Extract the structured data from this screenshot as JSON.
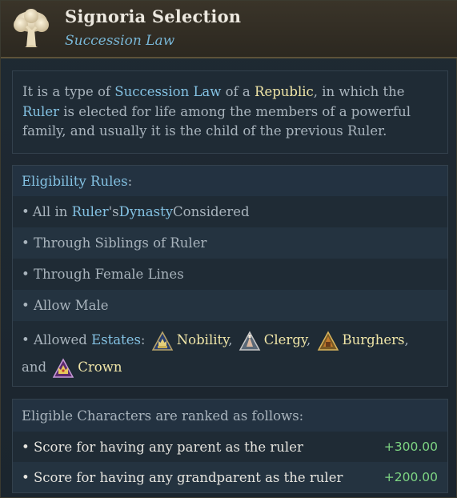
{
  "header": {
    "title": "Signoria Selection",
    "subtitle": "Succession Law",
    "icon": "tree-icon"
  },
  "description": {
    "part1": "It is a type of ",
    "kw1": "Succession Law",
    "part2": " of a ",
    "kw2": "Republic",
    "part3": ", in which the ",
    "kw3": "Ruler",
    "part4": " is elected for life among the members of a powerful family, and usually it is the child of the previous Ruler."
  },
  "eligibility": {
    "heading_kw": "Eligibility Rules",
    "heading_suffix": ":",
    "rule1": {
      "bullet": "•",
      "kw1": "Ruler",
      "t1": "'s ",
      "kw2": "Dynasty",
      "t2": " Considered",
      "t0": "All in "
    },
    "rule2": "• Through Siblings of Ruler",
    "rule3": "• Through Female Lines",
    "rule4": "• Allow Male",
    "estates_prefix": "• Allowed ",
    "estates_kw": "Estates",
    "estates_colon": ":",
    "estates": [
      {
        "name": "Nobility",
        "icon": "nobility-icon",
        "sep": ","
      },
      {
        "name": "Clergy",
        "icon": "clergy-icon",
        "sep": ","
      },
      {
        "name": "Burghers",
        "icon": "burghers-icon",
        "sep": ","
      },
      {
        "name": "Crown",
        "icon": "crown-icon",
        "sep": ""
      }
    ],
    "and_word": "and"
  },
  "ranking": {
    "heading": "Eligible Characters are ranked as follows:",
    "rows": [
      {
        "label": "• Score for having any parent as the ruler",
        "value": "+300.00"
      },
      {
        "label": "• Score for having any grandparent as the ruler",
        "value": "+200.00"
      }
    ]
  },
  "colors": {
    "keyword_blue": "#84c2e3",
    "keyword_gold": "#f0e6a8",
    "positive_green": "#7ed683"
  }
}
